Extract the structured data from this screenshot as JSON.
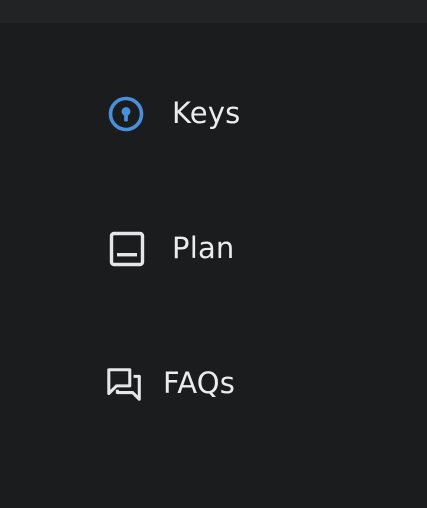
{
  "menu": {
    "items": [
      {
        "id": "keys",
        "label": "Keys",
        "icon": "key-circle-icon",
        "active": true
      },
      {
        "id": "plan",
        "label": "Plan",
        "icon": "plan-panel-icon",
        "active": false
      },
      {
        "id": "faqs",
        "label": "FAQs",
        "icon": "chat-bubbles-icon",
        "active": false
      }
    ]
  },
  "colors": {
    "background": "#1b1c1e",
    "topbar": "#222325",
    "text": "#ececec",
    "accent": "#4a8fdc",
    "icon": "#e6e6e6"
  }
}
